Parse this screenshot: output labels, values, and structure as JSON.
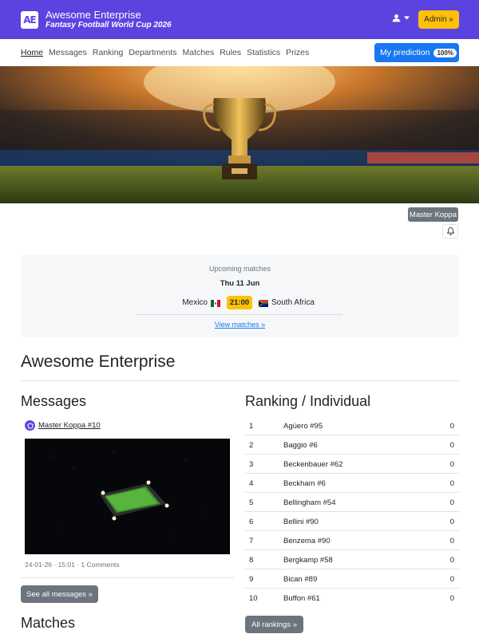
{
  "header": {
    "logo_text": "AE",
    "title": "Awesome Enterprise",
    "subtitle": "Fantasy Football World Cup 2026",
    "admin_label": "Admin »",
    "user_icon": "user-icon",
    "bg_color": "#5b43e0"
  },
  "nav": {
    "items": [
      {
        "label": "Home"
      },
      {
        "label": "Messages"
      },
      {
        "label": "Ranking"
      },
      {
        "label": "Departments"
      },
      {
        "label": "Matches"
      },
      {
        "label": "Rules"
      },
      {
        "label": "Statistics"
      },
      {
        "label": "Prizes"
      }
    ],
    "prediction_label": "My prediction",
    "prediction_badge": "100%"
  },
  "profile": {
    "name": "Master Koppa",
    "bell_icon": "bell-icon"
  },
  "upcoming": {
    "title": "Upcoming matches",
    "date": "Thu 11 Jun",
    "home_team": "Mexico",
    "away_team": "South Africa",
    "time": "21:00",
    "link": "View matches »"
  },
  "company": {
    "title": "Awesome Enterprise"
  },
  "messages": {
    "title": "Messages",
    "author": "Master Koppa #10",
    "meta": "24-01-26 · 15:01 · 1 Comments",
    "see_all": "See all messages »"
  },
  "matches": {
    "title": "Matches"
  },
  "ranking": {
    "title": "Ranking / Individual",
    "rows": [
      {
        "pos": "1",
        "name": "Agüero #95",
        "pts": "0"
      },
      {
        "pos": "2",
        "name": "Baggio #6",
        "pts": "0"
      },
      {
        "pos": "3",
        "name": "Beckenbauer #62",
        "pts": "0"
      },
      {
        "pos": "4",
        "name": "Beckham #6",
        "pts": "0"
      },
      {
        "pos": "5",
        "name": "Bellingham #54",
        "pts": "0"
      },
      {
        "pos": "6",
        "name": "Bellini #90",
        "pts": "0"
      },
      {
        "pos": "7",
        "name": "Benzema #90",
        "pts": "0"
      },
      {
        "pos": "8",
        "name": "Bergkamp #58",
        "pts": "0"
      },
      {
        "pos": "9",
        "name": "Bican #89",
        "pts": "0"
      },
      {
        "pos": "10",
        "name": "Buffon #61",
        "pts": "0"
      }
    ],
    "all_label": "All rankings »"
  },
  "colors": {
    "accent": "#5b43e0",
    "primary_button": "#1778f2",
    "warning": "#ffc107",
    "secondary": "#6c757d"
  }
}
